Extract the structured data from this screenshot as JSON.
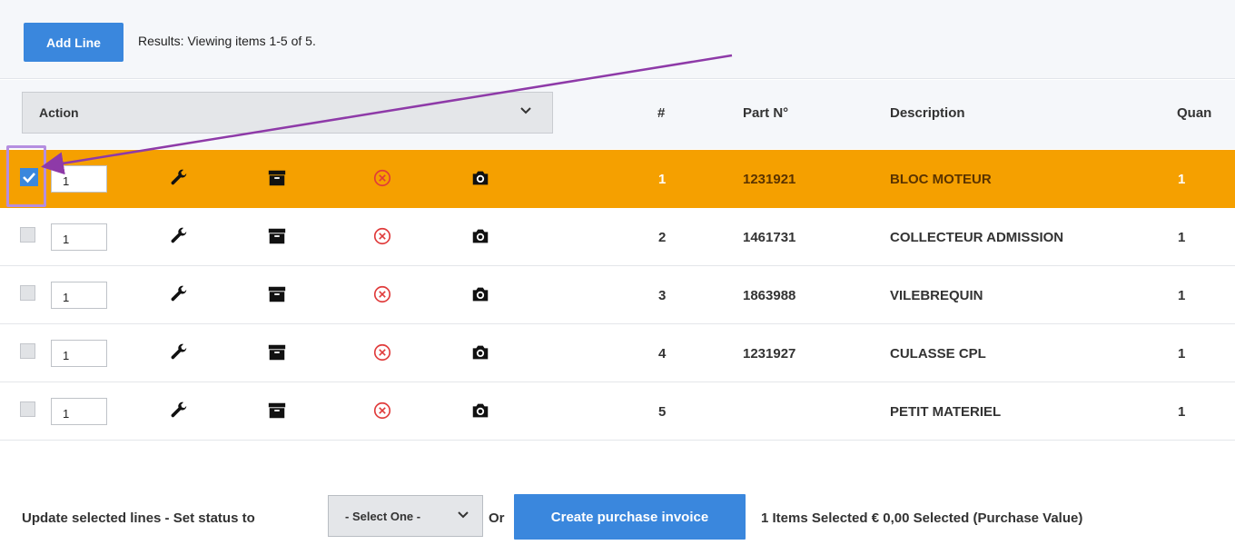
{
  "toolbar": {
    "add_line_label": "Add Line",
    "results_text": "Results: Viewing items 1-5 of 5."
  },
  "table": {
    "action_select_value": "Action",
    "columns": {
      "num": "#",
      "part": "Part N°",
      "description": "Description",
      "quantity": "Quan"
    },
    "rows": [
      {
        "qty": "1",
        "num": "1",
        "part": "1231921",
        "description": "BLOC MOTEUR",
        "quantity": "1",
        "checked": true
      },
      {
        "qty": "1",
        "num": "2",
        "part": "1461731",
        "description": "COLLECTEUR ADMISSION",
        "quantity": "1",
        "checked": false
      },
      {
        "qty": "1",
        "num": "3",
        "part": "1863988",
        "description": "VILEBREQUIN",
        "quantity": "1",
        "checked": false
      },
      {
        "qty": "1",
        "num": "4",
        "part": "1231927",
        "description": "CULASSE CPL",
        "quantity": "1",
        "checked": false
      },
      {
        "qty": "1",
        "num": "5",
        "part": "",
        "description": "PETIT MATERIEL",
        "quantity": "1",
        "checked": false
      }
    ],
    "row_icons": [
      "wrench-icon",
      "archive-icon",
      "remove-circle-icon",
      "camera-icon"
    ]
  },
  "footer": {
    "update_label": "Update selected lines - Set status to",
    "status_select_value": "- Select One -",
    "or_label": "Or",
    "create_invoice_label": "Create purchase invoice",
    "selection_summary": "1 Items Selected € 0,00 Selected (Purchase Value)"
  },
  "colors": {
    "accent_blue": "#3a87dd",
    "selected_row": "#f5a000",
    "remove_icon": "#e03b3b",
    "annotation_arrow": "#8e3aa8"
  }
}
